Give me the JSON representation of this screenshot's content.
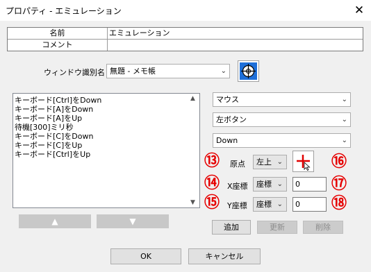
{
  "window": {
    "title": "プロパティ - エミュレーション",
    "close_label": "✕"
  },
  "grid": {
    "rows": [
      {
        "label": "名前",
        "value": "エミュレーション"
      },
      {
        "label": "コメント",
        "value": ""
      }
    ]
  },
  "window_id": {
    "label": "ウィンドウ識別名",
    "value": "無題 - メモ帳",
    "arrow": "⌄"
  },
  "list": {
    "items": [
      "キーボード[Ctrl]をDown",
      "キーボード[A]をDown",
      "キーボード[A]をUp",
      "待機[300]ミリ秒",
      "キーボード[C]をDown",
      "キーボード[C]をUp",
      "キーボード[Ctrl]をUp"
    ]
  },
  "move_up_label": "▲",
  "move_down_label": "▼",
  "device": {
    "value": "マウス",
    "arrow": "⌄"
  },
  "mouse_button": {
    "value": "左ボタン",
    "arrow": "⌄"
  },
  "action": {
    "value": "Down",
    "arrow": "⌄"
  },
  "origin": {
    "label": "原点",
    "value": "左上",
    "arrow": "⌄"
  },
  "x": {
    "label": "X座標",
    "mode": "座標",
    "value": "0",
    "arrow": "⌄"
  },
  "y": {
    "label": "Y座標",
    "mode": "座標",
    "value": "0",
    "arrow": "⌄"
  },
  "markers": {
    "m13": "⑬",
    "m14": "⑭",
    "m15": "⑮",
    "m16": "⑯",
    "m17": "⑰",
    "m18": "⑱"
  },
  "buttons": {
    "add": "追加",
    "update": "更新",
    "delete": "削除",
    "ok": "OK",
    "cancel": "キャンセル"
  },
  "colors": {
    "marker": "#e60000",
    "crosshair": "#e00000"
  }
}
